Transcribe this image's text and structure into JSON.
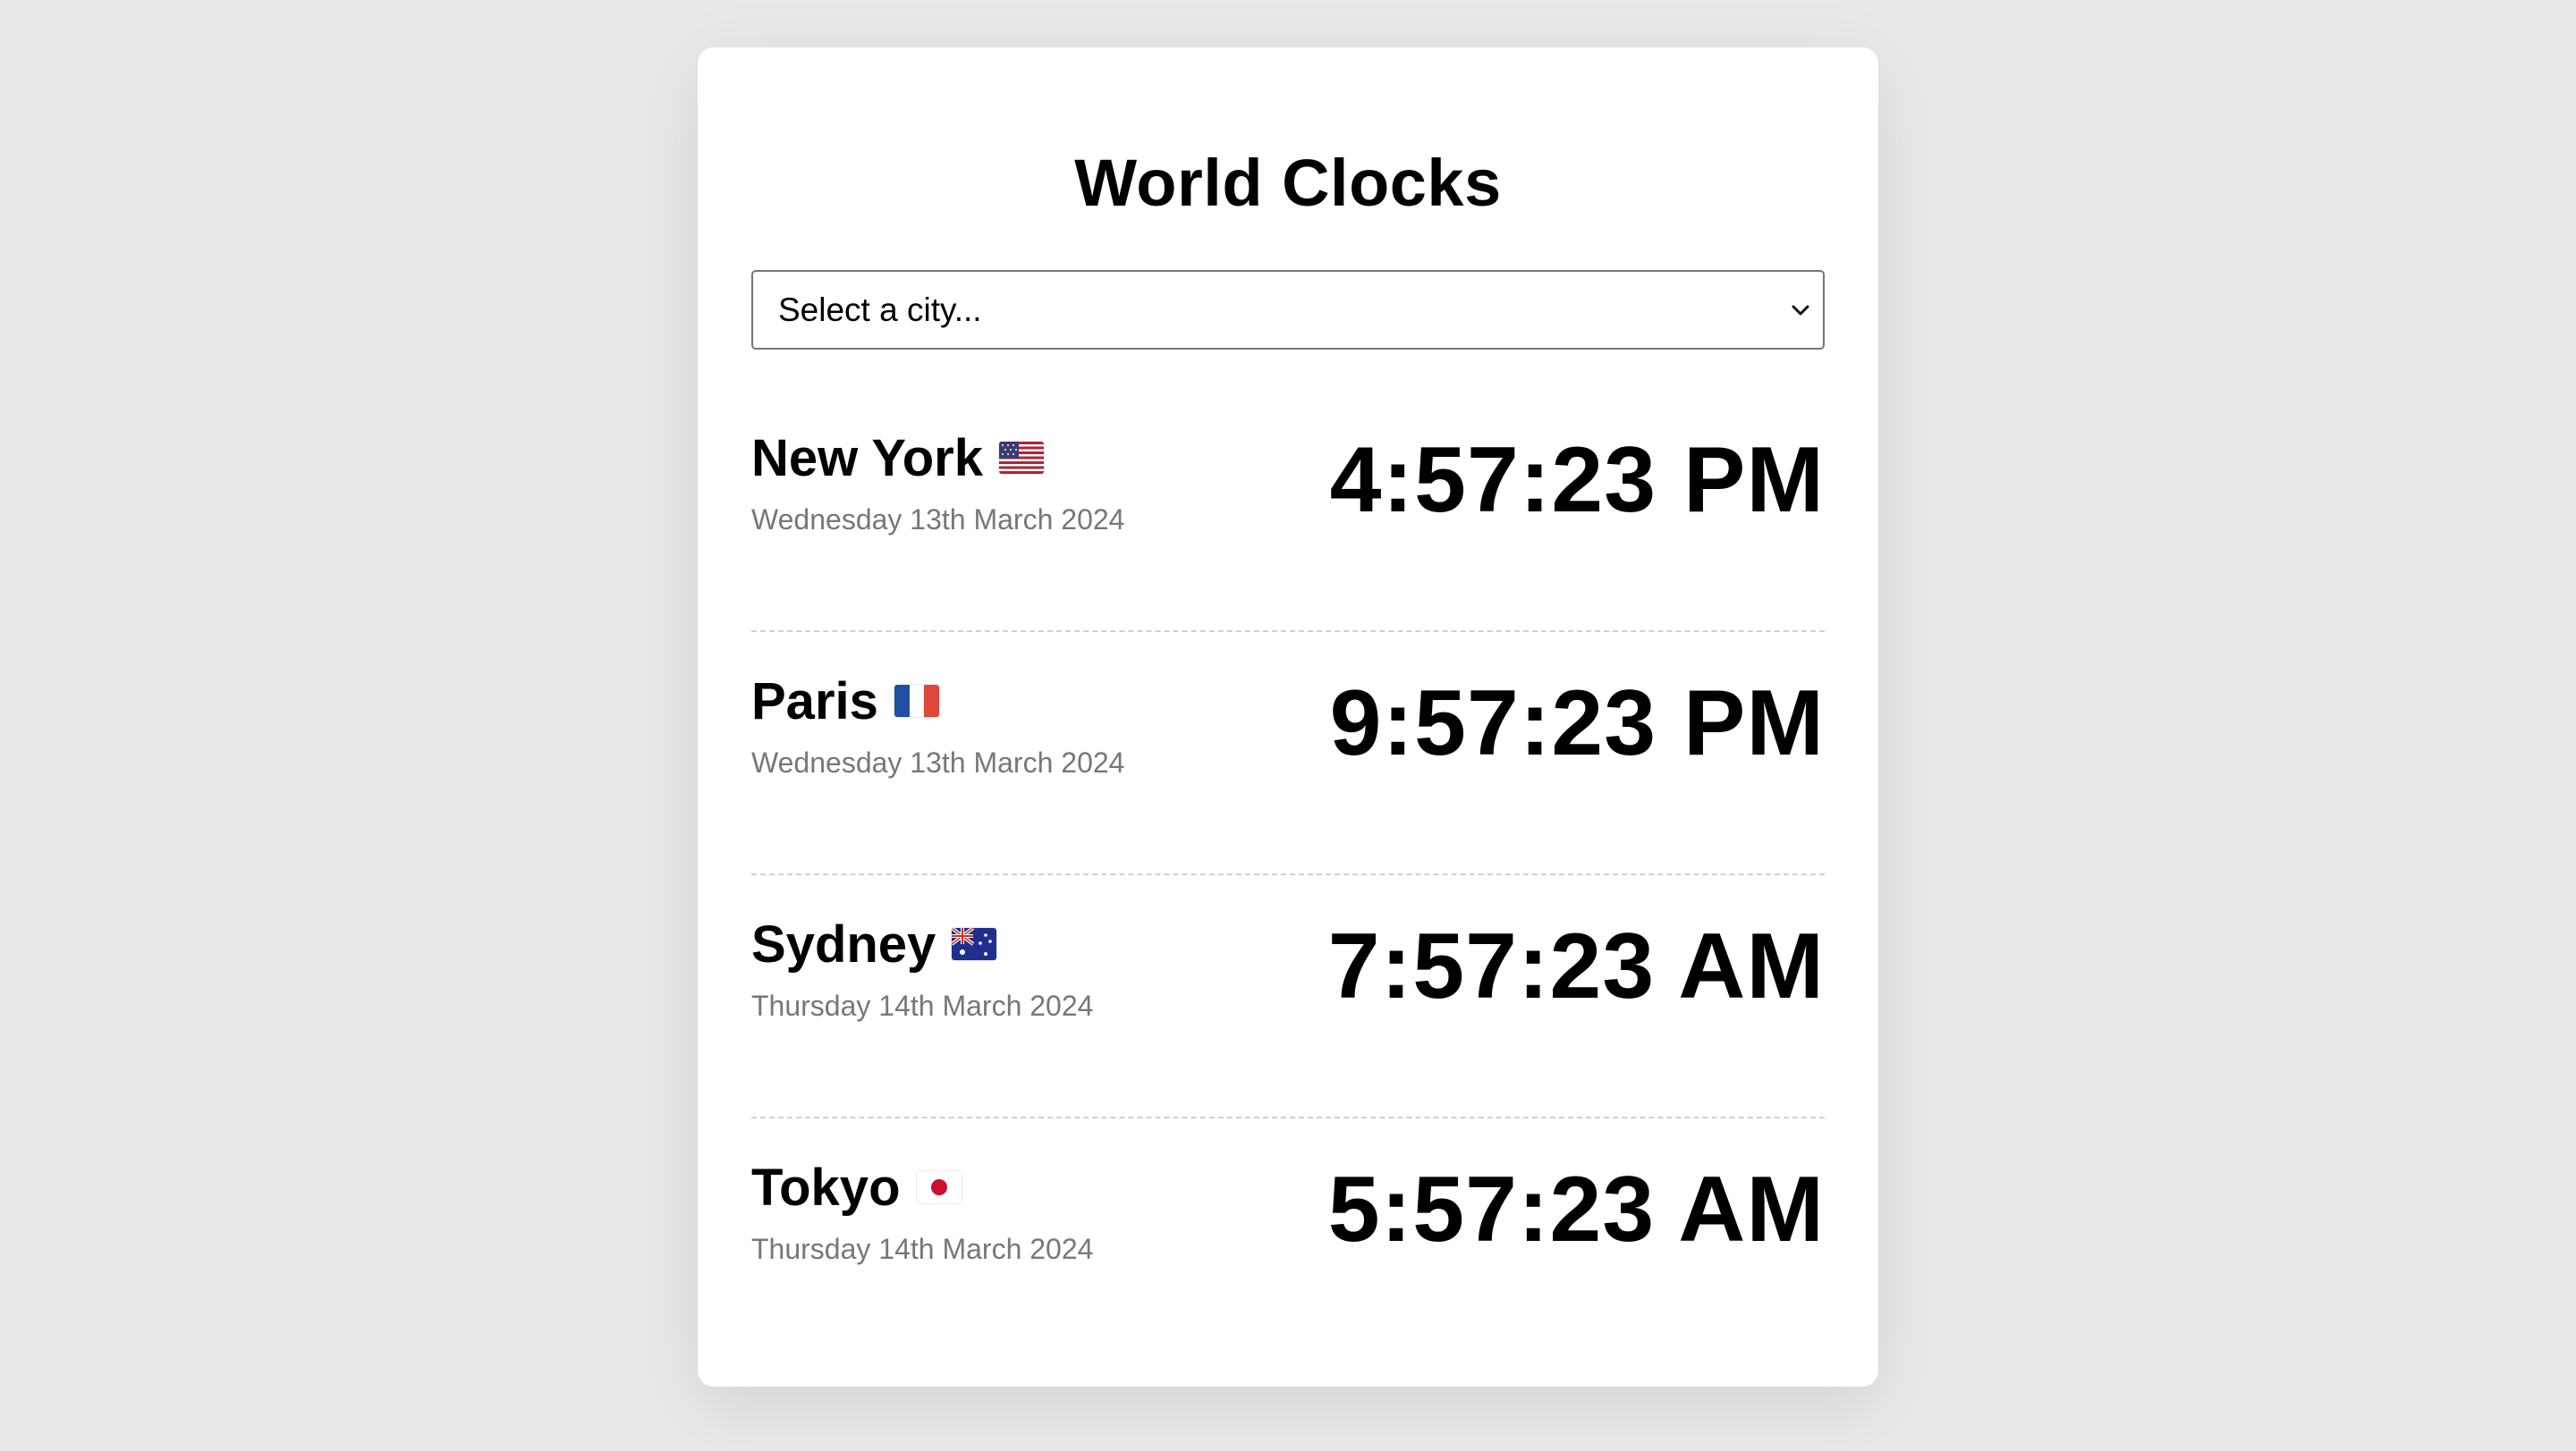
{
  "page": {
    "title": "World Clocks"
  },
  "select": {
    "value": "Select a city..."
  },
  "cities": [
    {
      "name": "New York",
      "flag": "us-flag-icon",
      "date": "Wednesday 13th March 2024",
      "time": "4:57:23 PM"
    },
    {
      "name": "Paris",
      "flag": "france-flag-icon",
      "date": "Wednesday 13th March 2024",
      "time": "9:57:23 PM"
    },
    {
      "name": "Sydney",
      "flag": "australia-flag-icon",
      "date": "Thursday 14th March 2024",
      "time": "7:57:23 AM"
    },
    {
      "name": "Tokyo",
      "flag": "japan-flag-icon",
      "date": "Thursday 14th March 2024",
      "time": "5:57:23 AM"
    }
  ],
  "colors": {
    "background": "#e9e9ec",
    "card": "#ffffff",
    "date_text": "#777777",
    "divider": "#cfcfcf"
  }
}
